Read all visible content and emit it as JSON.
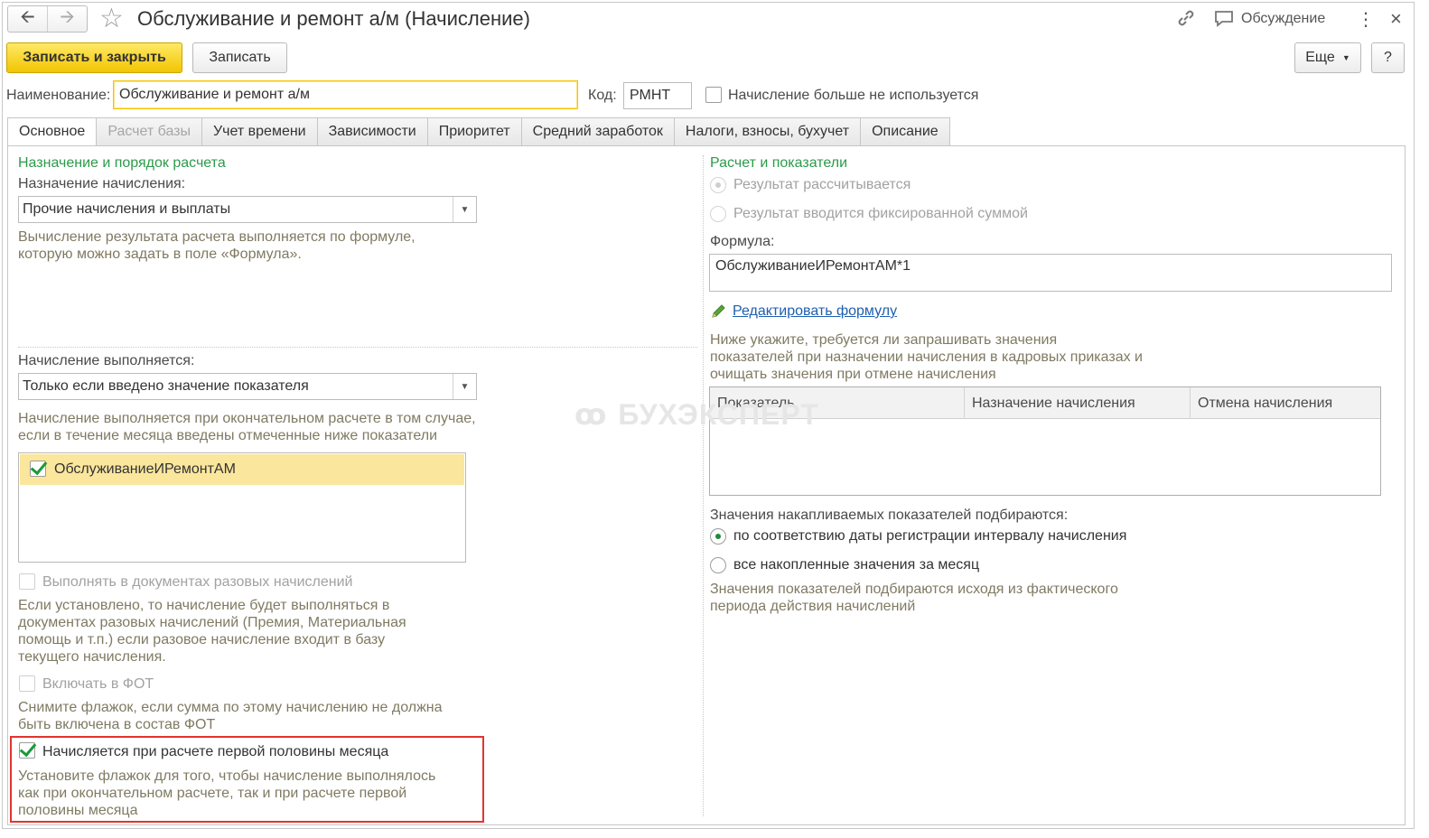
{
  "window": {
    "title": "Обслуживание и ремонт а/м (Начисление)",
    "discuss_label": "Обсуждение",
    "more_icon": "⋮",
    "close_icon": "×"
  },
  "toolbar": {
    "save_close": "Записать и закрыть",
    "save": "Записать",
    "more": "Еще",
    "help": "?"
  },
  "form": {
    "name_label": "Наименование:",
    "name_value": "Обслуживание и ремонт а/м",
    "code_label": "Код:",
    "code_value": "РМНТ",
    "unused_label": "Начисление больше не используется"
  },
  "tabs": [
    {
      "label": "Основное",
      "state": "active"
    },
    {
      "label": "Расчет базы",
      "state": "disabled"
    },
    {
      "label": "Учет времени",
      "state": "normal"
    },
    {
      "label": "Зависимости",
      "state": "normal"
    },
    {
      "label": "Приоритет",
      "state": "normal"
    },
    {
      "label": "Средний заработок",
      "state": "normal"
    },
    {
      "label": "Налоги, взносы, бухучет",
      "state": "normal"
    },
    {
      "label": "Описание",
      "state": "normal"
    }
  ],
  "left": {
    "section_title": "Назначение и порядок расчета",
    "purpose_label": "Назначение начисления:",
    "purpose_value": "Прочие начисления и выплаты",
    "purpose_hint_1": "Вычисление результата расчета выполняется по формуле,",
    "purpose_hint_2": "которую можно задать в поле «Формула».",
    "exec_label": "Начисление выполняется:",
    "exec_value": "Только если введено значение показателя",
    "exec_hint_1": "Начисление выполняется при окончательном расчете в том случае,",
    "exec_hint_2": "если в течение месяца введены отмеченные ниже показатели",
    "indicator_item": "ОбслуживаниеИРемонтАМ",
    "onetime_label": "Выполнять в документах разовых начислений",
    "onetime_hint_1": "Если установлено, то начисление будет выполняться в",
    "onetime_hint_2": "документах разовых начислений (Премия, Материальная",
    "onetime_hint_3": "помощь и т.п.) если разовое начисление входит в базу",
    "onetime_hint_4": "текущего начисления.",
    "fot_label": "Включать в ФОТ",
    "fot_hint_1": "Снимите флажок, если сумма по этому начислению не должна",
    "fot_hint_2": "быть включена в состав ФОТ",
    "firsthalf_label": "Начисляется при расчете первой половины месяца",
    "firsthalf_hint_1": "Установите флажок для того, чтобы начисление выполнялось",
    "firsthalf_hint_2": "как при окончательном расчете, так и при расчете первой",
    "firsthalf_hint_3": "половины месяца"
  },
  "right": {
    "section_title": "Расчет и показатели",
    "radio_calc": "Результат рассчитывается",
    "radio_fixed": "Результат вводится фиксированной суммой",
    "formula_label": "Формула:",
    "formula_value": "ОбслуживаниеИРемонтАМ*1",
    "edit_formula_link": "Редактировать формулу",
    "request_hint_1": "Ниже укажите, требуется ли запрашивать значения",
    "request_hint_2": "показателей при назначении начисления в кадровых приказах и",
    "request_hint_3": "очищать значения при отмене начисления",
    "grid_columns": [
      "Показатель",
      "Назначение начисления",
      "Отмена начисления"
    ],
    "accum_label": "Значения накапливаемых показателей подбираются:",
    "accum_radio_1": "по соответствию даты регистрации интервалу начисления",
    "accum_radio_2": "все накопленные значения за месяц",
    "accum_hint_1": "Значения показателей подбираются исходя из фактического",
    "accum_hint_2": "периода действия начислений"
  },
  "watermark": "БУХЭКСПЕРТ",
  "colors": {
    "accent_green": "#2b9b4a",
    "primary_button": "#f2c500",
    "highlight_red": "#e2342e",
    "hint_text": "#7f7a62",
    "link": "#1e5fb0"
  }
}
